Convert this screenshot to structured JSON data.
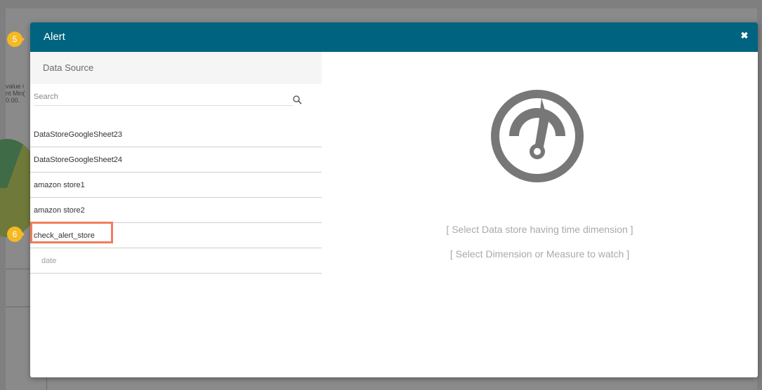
{
  "background": {
    "partial_text": [
      "value i",
      "nt Min(",
      "0.00."
    ]
  },
  "modal": {
    "title": "Alert",
    "close_icon": "close-icon",
    "data_source_header": "Data Source",
    "search": {
      "placeholder": "Search",
      "value": ""
    },
    "list_items": [
      {
        "label": "DataStoreGoogleSheet23"
      },
      {
        "label": "DataStoreGoogleSheet24"
      },
      {
        "label": "amazon store1"
      },
      {
        "label": "amazon store2"
      },
      {
        "label": "check_alert_store"
      },
      {
        "label": "date"
      }
    ],
    "messages": {
      "line1": "[ Select Data store having time dimension ]",
      "line2": "[ Select Dimension or Measure to watch ]"
    }
  },
  "badges": {
    "step5": "5",
    "step6": "6"
  },
  "colors": {
    "header": "#00637f",
    "badge": "#f5b922",
    "highlight": "#f07d5e",
    "gauge": "#777777"
  }
}
